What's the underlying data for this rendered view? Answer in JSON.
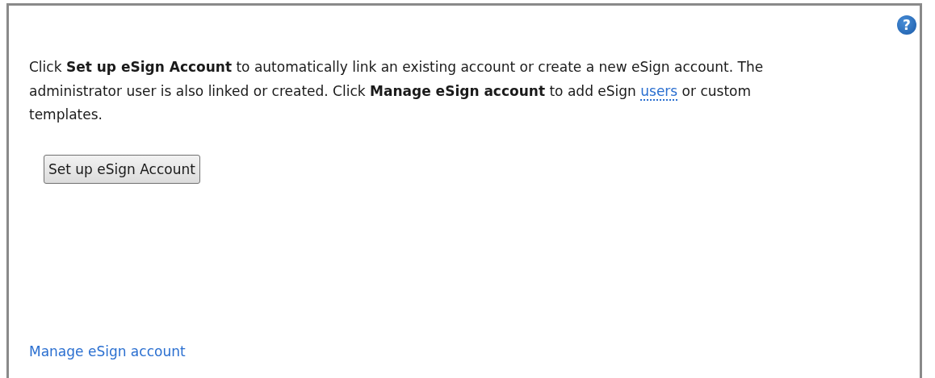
{
  "help_button": {
    "label": "?"
  },
  "intro": {
    "text_before": "Click **Set up eSign Account** to automatically link an existing account or create a new eSign account. The administrator user is also linked or created. Click **Manage eSign account** to add eSign ",
    "link": "users",
    "text_after": " or custom templates."
  },
  "setup_button": {
    "label": "Set up eSign Account"
  },
  "manage_link": {
    "label": "Manage eSign account"
  }
}
